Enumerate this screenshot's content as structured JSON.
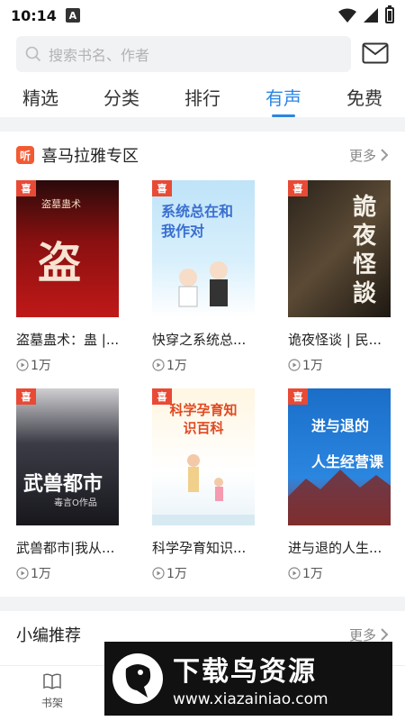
{
  "status": {
    "time": "10:14",
    "notif_badge": "A"
  },
  "search": {
    "placeholder": "搜索书名、作者"
  },
  "tabs": [
    {
      "label": "精选"
    },
    {
      "label": "分类"
    },
    {
      "label": "排行"
    },
    {
      "label": "有声",
      "active": true
    },
    {
      "label": "免费"
    }
  ],
  "section1": {
    "logo": "听",
    "title": "喜马拉雅专区",
    "more": "更多",
    "tag": "喜",
    "books": [
      {
        "title": "盗墓蛊术：蛊 |...",
        "plays": "1万",
        "cover_text": "盗",
        "cover_sub": "盗墓蛊术"
      },
      {
        "title": "快穿之系统总...",
        "plays": "1万",
        "cover_text": "系统总在和我作对"
      },
      {
        "title": "诡夜怪谈 | 民...",
        "plays": "1万",
        "cover_text": "詭夜怪談"
      },
      {
        "title": "武兽都市|我从...",
        "plays": "1万",
        "cover_text": "武兽都市",
        "cover_sub": "毒言O作品"
      },
      {
        "title": "科学孕育知识...",
        "plays": "1万",
        "cover_text": "科学孕育知识百科"
      },
      {
        "title": "进与退的人生...",
        "plays": "1万",
        "cover_text": "进与退的 人生经营课"
      }
    ]
  },
  "section2": {
    "title": "小编推荐",
    "more": "更多"
  },
  "bottom_nav": {
    "shelf_label": "书架"
  },
  "watermark": {
    "title": "下载鸟资源",
    "url": "www.xiazainiao.com"
  },
  "colors": {
    "accent": "#2b85e4",
    "tag_red": "#e84a36",
    "xm_orange": "#f25b32"
  }
}
